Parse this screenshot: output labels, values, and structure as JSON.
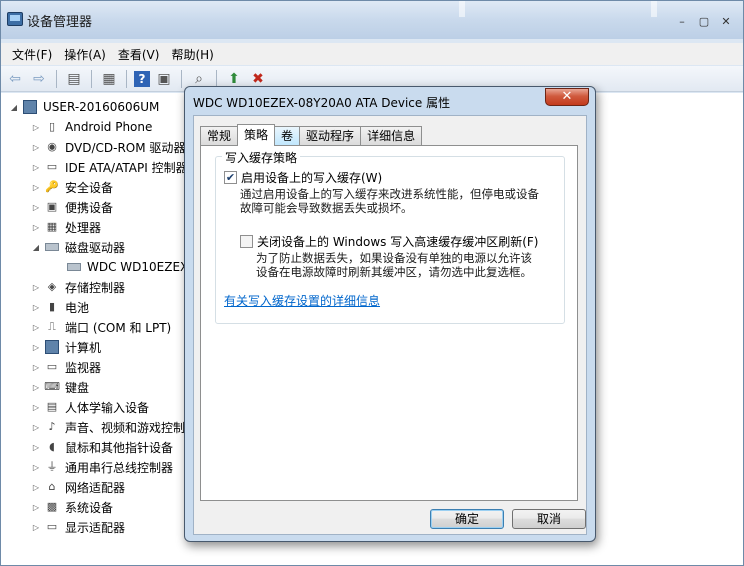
{
  "window": {
    "title": "设备管理器",
    "controls": [
      "–",
      "▢",
      "✕"
    ]
  },
  "menu": [
    "文件(F)",
    "操作(A)",
    "查看(V)",
    "帮助(H)"
  ],
  "tree": {
    "root": "USER-20160606UM",
    "items": [
      {
        "label": "Android Phone",
        "icon": "phone-icon"
      },
      {
        "label": "DVD/CD-ROM 驱动器",
        "icon": "dvd-icon"
      },
      {
        "label": "IDE ATA/ATAPI 控制器",
        "icon": "ide-icon"
      },
      {
        "label": "安全设备",
        "icon": "security-icon"
      },
      {
        "label": "便携设备",
        "icon": "portable-icon"
      },
      {
        "label": "处理器",
        "icon": "cpu-icon"
      },
      {
        "label": "磁盘驱动器",
        "icon": "disk-icon",
        "expanded": true
      },
      {
        "label": "WDC WD10EZEX",
        "icon": "disk-icon",
        "child": true
      },
      {
        "label": "存储控制器",
        "icon": "storage-icon"
      },
      {
        "label": "电池",
        "icon": "battery-icon"
      },
      {
        "label": "端口 (COM 和 LPT)",
        "icon": "port-icon"
      },
      {
        "label": "计算机",
        "icon": "computer-icon"
      },
      {
        "label": "监视器",
        "icon": "monitor-icon"
      },
      {
        "label": "键盘",
        "icon": "keyboard-icon"
      },
      {
        "label": "人体学输入设备",
        "icon": "hid-icon"
      },
      {
        "label": "声音、视频和游戏控制器",
        "icon": "sound-icon"
      },
      {
        "label": "鼠标和其他指针设备",
        "icon": "mouse-icon"
      },
      {
        "label": "通用串行总线控制器",
        "icon": "usb-icon"
      },
      {
        "label": "网络适配器",
        "icon": "network-icon"
      },
      {
        "label": "系统设备",
        "icon": "system-icon"
      },
      {
        "label": "显示适配器",
        "icon": "display-icon"
      }
    ]
  },
  "dialog": {
    "title": "WDC WD10EZEX-08Y20A0 ATA Device 属性",
    "close": "✕",
    "tabs": [
      "常规",
      "策略",
      "卷",
      "驱动程序",
      "详细信息"
    ],
    "group_title": "写入缓存策略",
    "option1": {
      "label": "启用设备上的写入缓存(W)",
      "checked": true,
      "desc_line1": "通过启用设备上的写入缓存来改进系统性能，但停电或设备",
      "desc_line2": "故障可能会导致数据丢失或损坏。"
    },
    "option2": {
      "label": "关闭设备上的 Windows 写入高速缓存缓冲区刷新(F)",
      "checked": false,
      "desc_line1": "为了防止数据丢失，如果设备没有单独的电源以允许该",
      "desc_line2": "设备在电源故障时刷新其缓冲区，请勿选中此复选框。"
    },
    "link": "有关写入缓存设置的详细信息",
    "ok": "确定",
    "cancel": "取消"
  }
}
